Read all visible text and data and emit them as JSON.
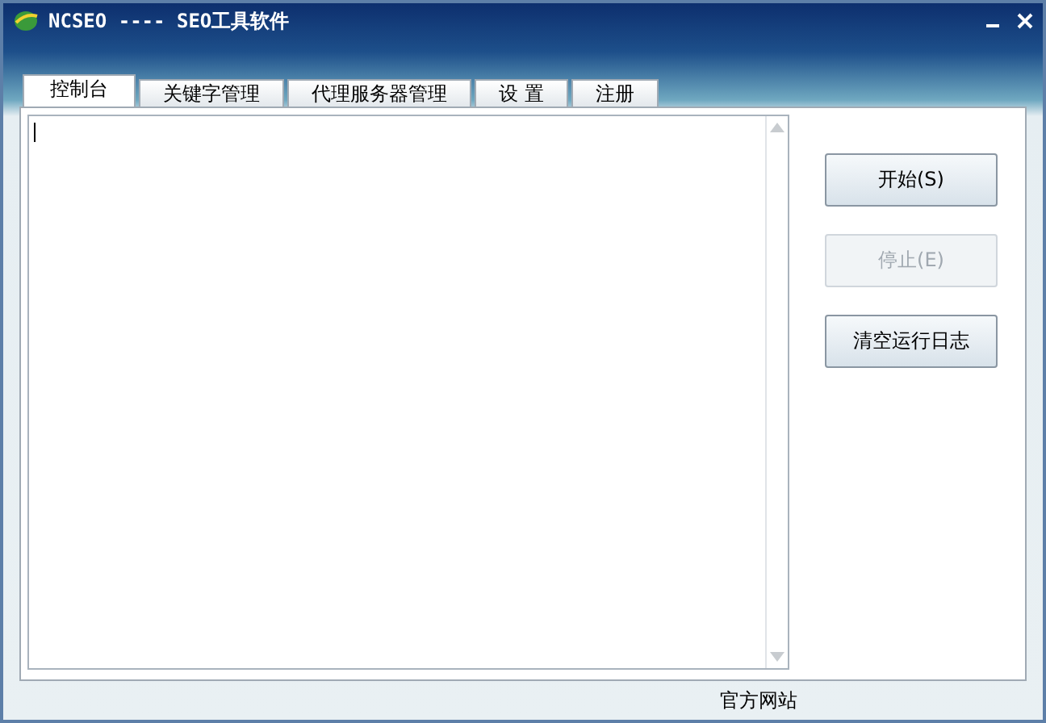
{
  "window": {
    "title": "NCSEO ---- SEO工具软件"
  },
  "tabs": [
    {
      "label": "控制台",
      "selected": true
    },
    {
      "label": "关键字管理",
      "selected": false
    },
    {
      "label": "代理服务器管理",
      "selected": false
    },
    {
      "label": "设 置",
      "selected": false
    },
    {
      "label": "注册",
      "selected": false
    }
  ],
  "buttons": [
    {
      "label": "开始(S)",
      "disabled": false
    },
    {
      "label": "停止(E)",
      "disabled": true
    },
    {
      "label": "清空运行日志",
      "disabled": false
    }
  ],
  "status_bar": {
    "link": "官方网站"
  }
}
